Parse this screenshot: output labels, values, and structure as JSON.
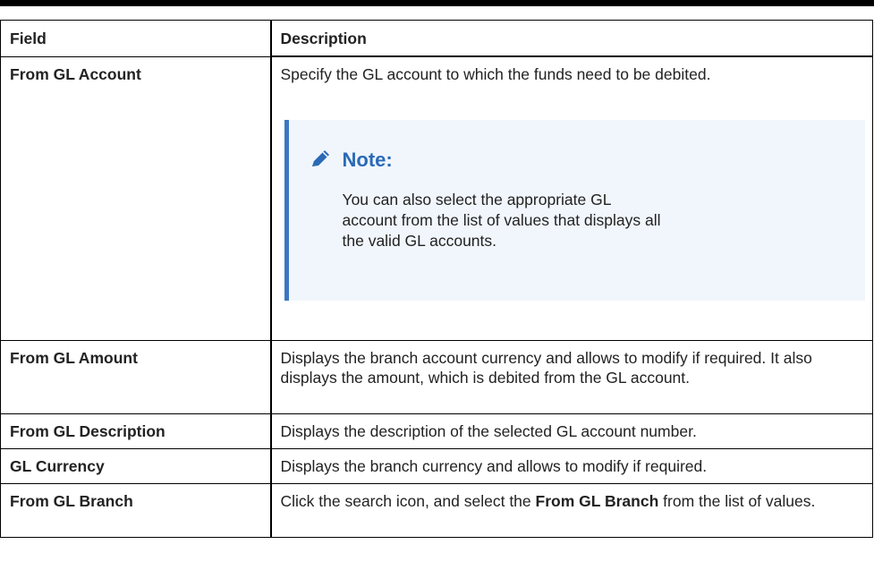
{
  "table": {
    "headers": {
      "field": "Field",
      "description": "Description"
    },
    "rows": [
      {
        "field": "From GL Account",
        "description": "Specify the GL account to which the funds need to be debited.",
        "note": {
          "title": "Note:",
          "body": "You can also select the appropriate GL account from the list of values that displays all the valid GL accounts.",
          "icon": "pencil-icon",
          "accent_color": "#3a78c1",
          "background_color": "#f1f6fc"
        }
      },
      {
        "field": "From GL Amount",
        "description": "Displays the branch account currency and allows to modify if required. It also displays the amount, which is debited from the GL account."
      },
      {
        "field": "From GL Description",
        "description": "Displays the description of the selected GL account number."
      },
      {
        "field": "GL Currency",
        "description": "Displays the branch currency and allows to modify if required."
      },
      {
        "field": "From GL Branch",
        "description_parts": [
          "Click the search icon, and select the ",
          "From GL Branch",
          " from the list of values."
        ]
      }
    ]
  }
}
